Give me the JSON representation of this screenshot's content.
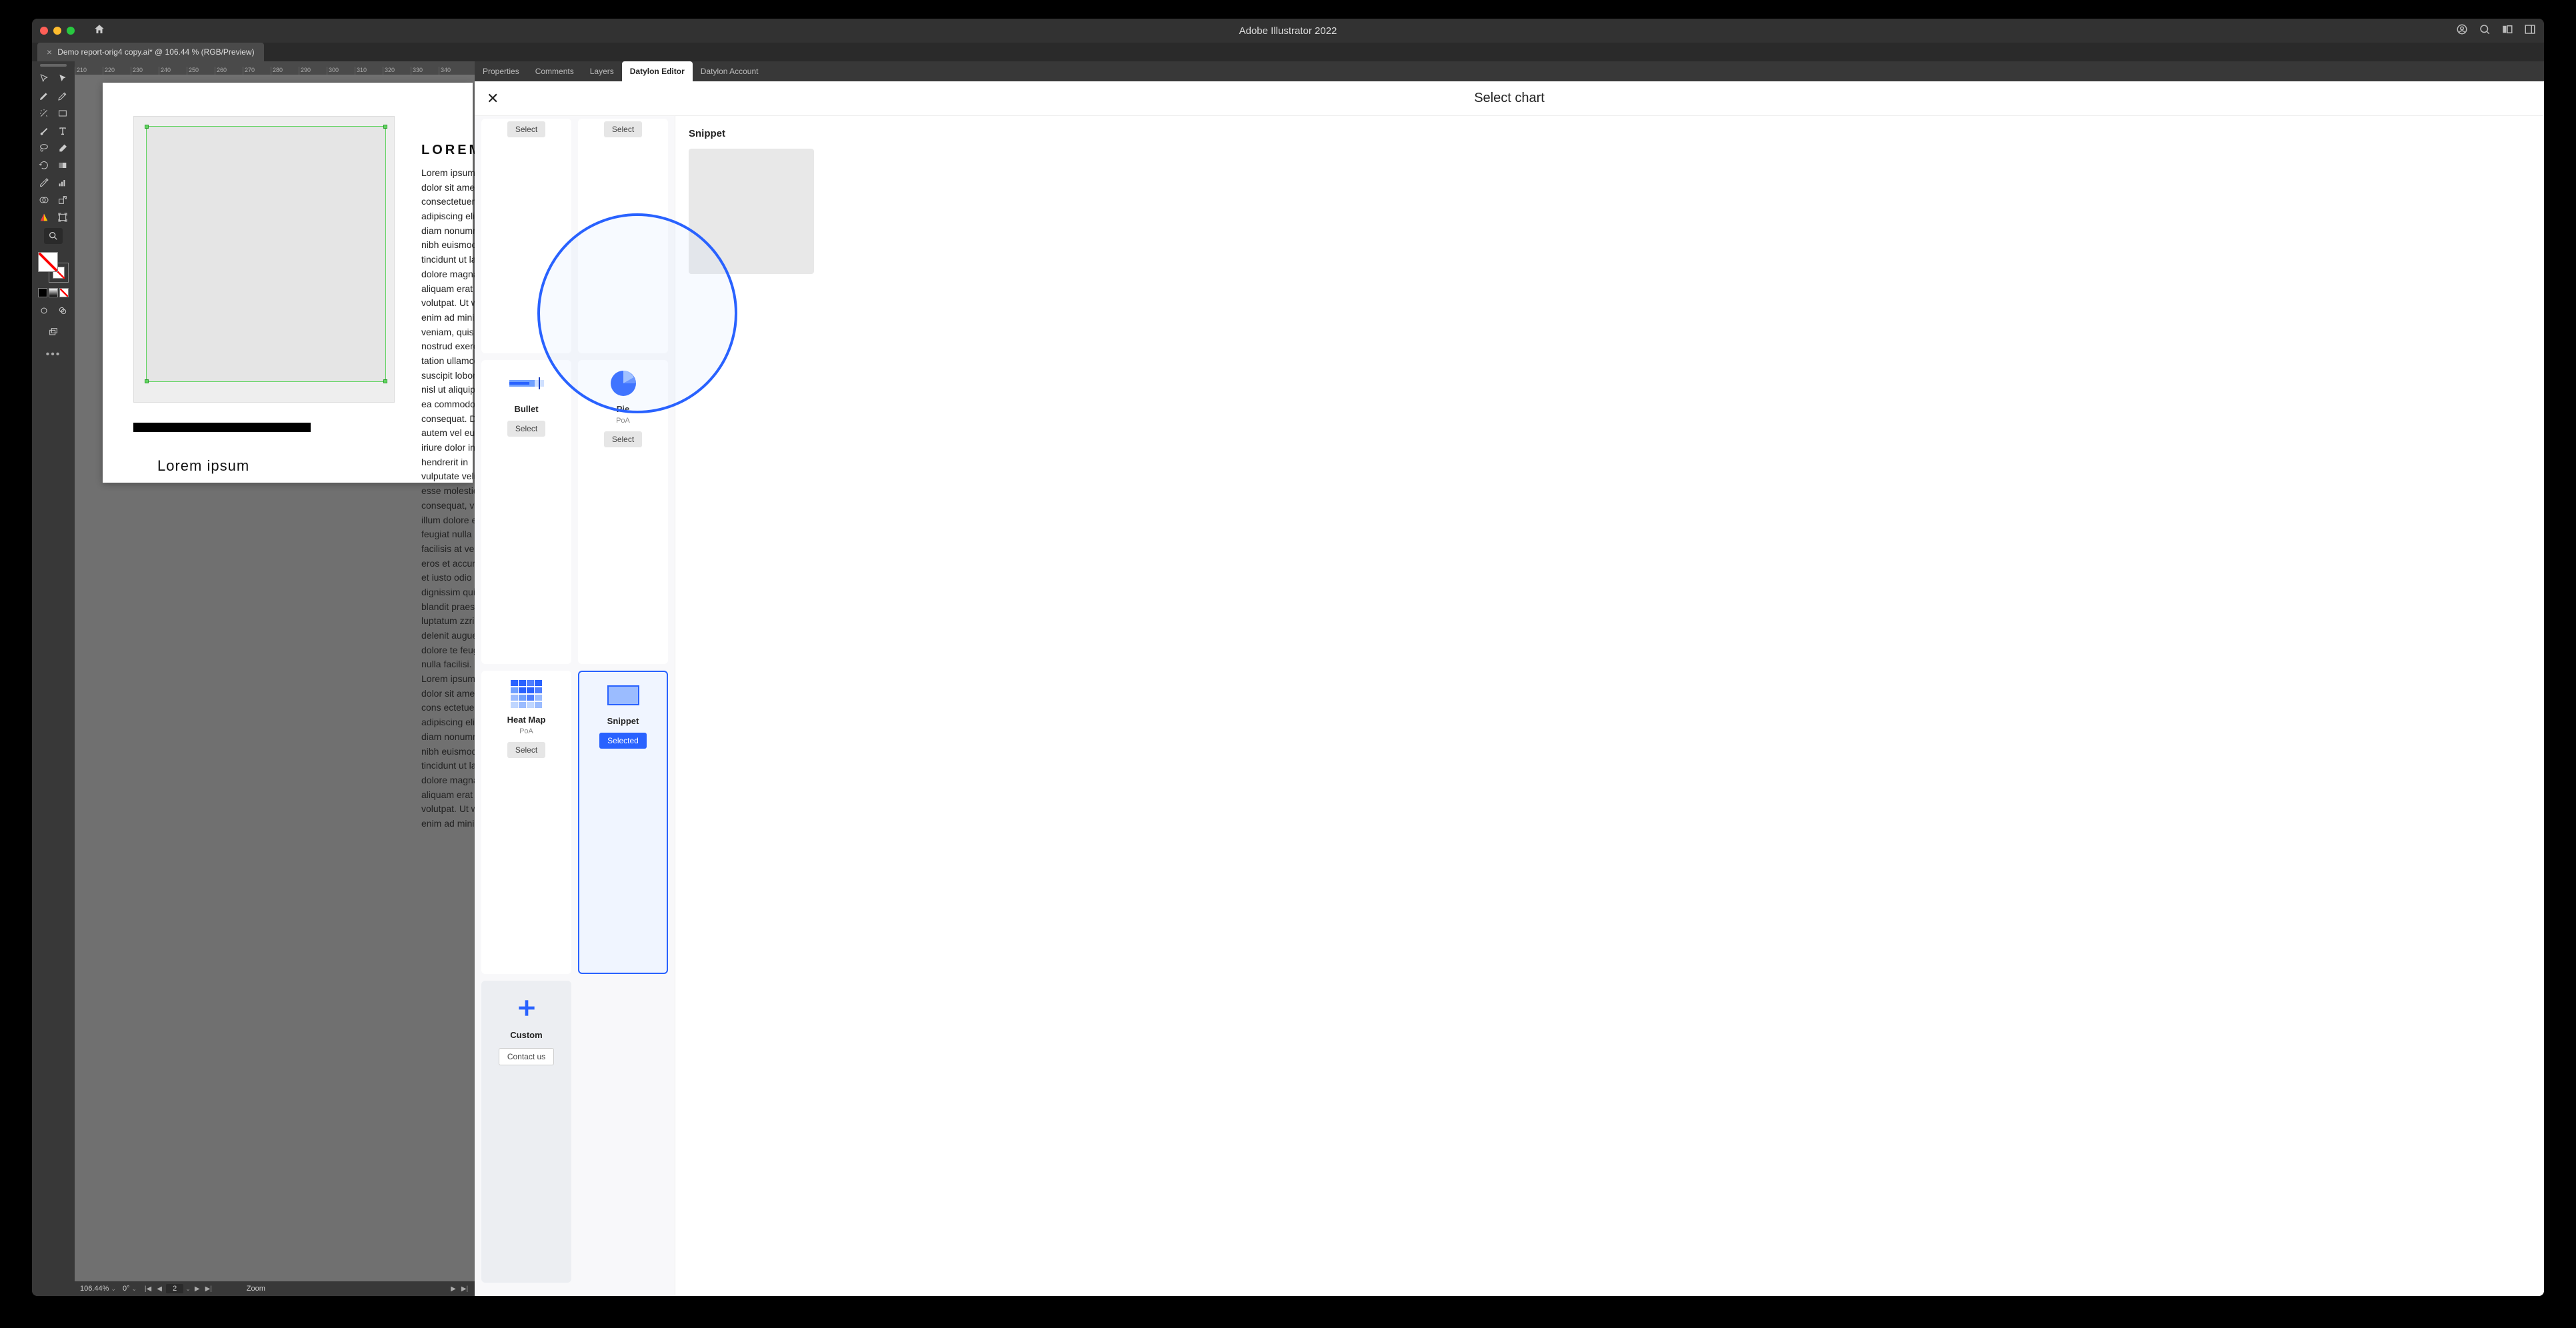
{
  "titlebar": {
    "app_title": "Adobe Illustrator 2022"
  },
  "doc_tab": {
    "close": "×",
    "label": "Demo report-orig4 copy.ai* @ 106.44 % (RGB/Preview)"
  },
  "ruler_ticks": [
    "210",
    "220",
    "230",
    "240",
    "250",
    "260",
    "270",
    "280",
    "290",
    "300",
    "310",
    "320",
    "330",
    "340"
  ],
  "artboard": {
    "heading": "LOREM",
    "body": "Lorem ipsum dolor sit amet, consectetuer adipiscing elit, sed diam nonummy nibh euismod tincidunt ut laoreet dolore magna aliquam erat volutpat. Ut wisi enim ad minim veniam, quis nostrud exerci tation ullamcorper suscipit lobortis nisl ut aliquip ex ea commodo consequat. Duis autem vel eum iriure dolor in hendrerit in vulputate velit esse molestie consequat, vel illum dolore eu feugiat nulla facilisis at vero eros et accumsan et iusto odio dignissim qui blandit praesent luptatum zzril delenit augue duis dolore te feugait nulla facilisi.\nLorem ipsum dolor sit amet, cons ectetuer adipiscing elit, sed diam nonummy nibh euismod tincidunt ut laoreet dolore magna aliquam erat volutpat. Ut wisi enim ad minim",
    "caption": "Lorem ipsum"
  },
  "statusbar": {
    "zoom": "106.44%",
    "angle": "0°",
    "page": "2",
    "zoom_label": "Zoom"
  },
  "panel_tabs": [
    "Properties",
    "Comments",
    "Layers",
    "Datylon Editor",
    "Datylon Account"
  ],
  "panel": {
    "title": "Select chart",
    "preview_title": "Snippet"
  },
  "cards": {
    "partial1": {
      "select": "Select"
    },
    "partial2": {
      "select": "Select"
    },
    "bullet": {
      "name": "Bullet",
      "select": "Select"
    },
    "pie": {
      "name": "Pie",
      "sub": "PoA",
      "select": "Select"
    },
    "heatmap": {
      "name": "Heat Map",
      "sub": "PoA",
      "select": "Select"
    },
    "snippet": {
      "name": "Snippet",
      "select": "Selected"
    },
    "custom": {
      "name": "Custom",
      "contact": "Contact us"
    }
  }
}
